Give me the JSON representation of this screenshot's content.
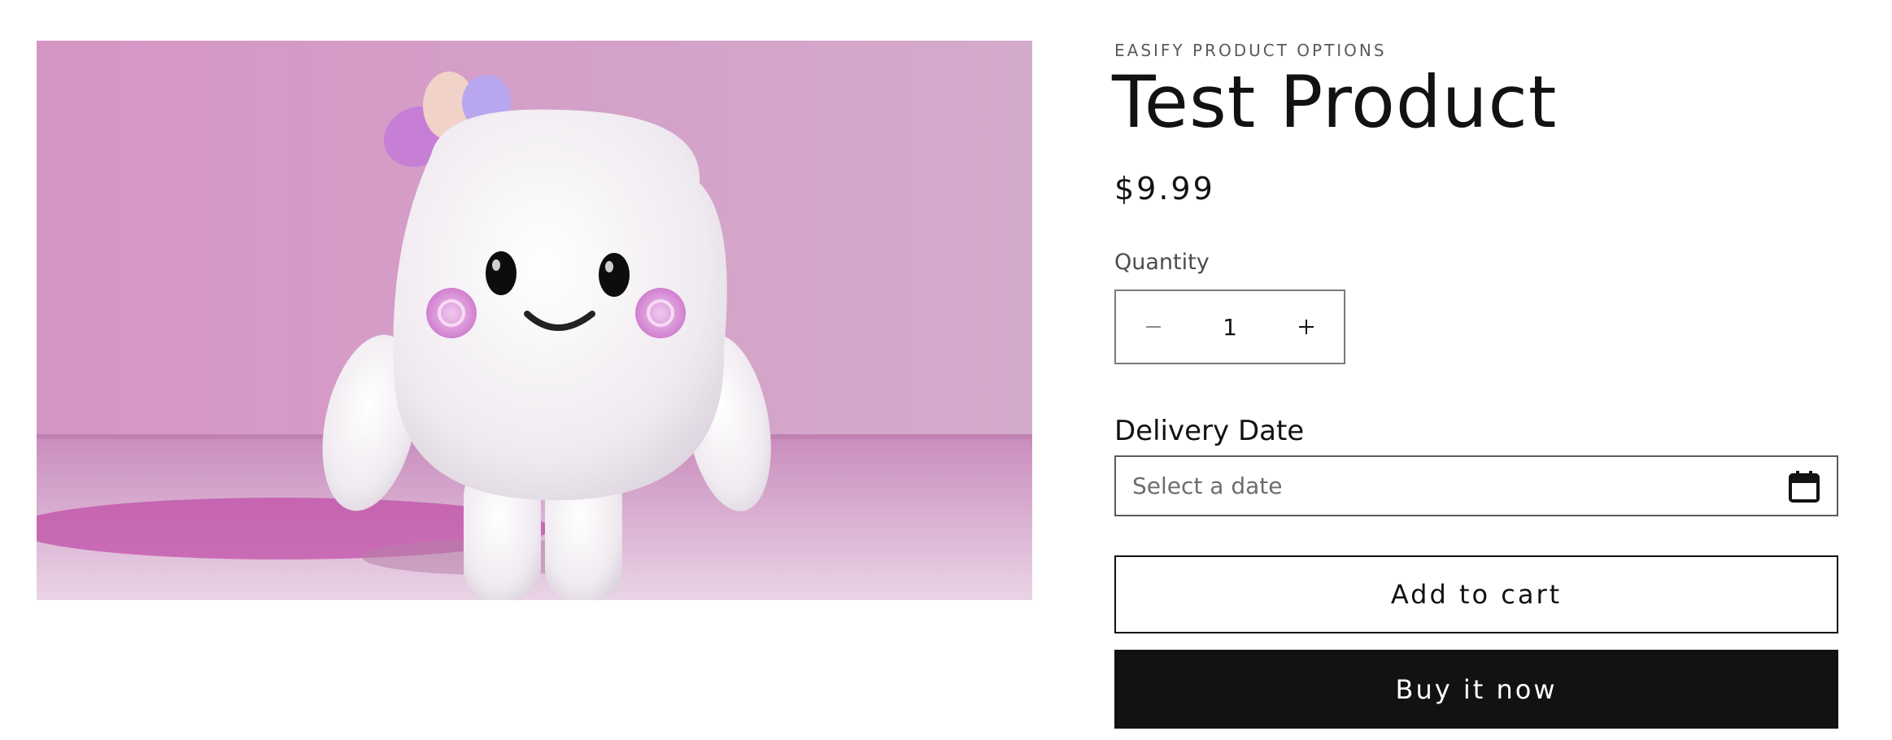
{
  "product": {
    "image_alt": "Pink background with white marshmallow character",
    "vendor": "EASIFY PRODUCT OPTIONS",
    "title": "Test Product",
    "price": "$9.99"
  },
  "quantity": {
    "label": "Quantity",
    "value": "1",
    "decrease_icon": "minus-icon",
    "increase_icon": "plus-icon"
  },
  "delivery": {
    "label": "Delivery Date",
    "placeholder": "Select a date",
    "icon": "calendar-icon"
  },
  "actions": {
    "add_to_cart": "Add to cart",
    "buy_now": "Buy it now"
  },
  "colors": {
    "text": "#121212",
    "button_dark": "#121212",
    "image_background": "#d59bc6"
  }
}
